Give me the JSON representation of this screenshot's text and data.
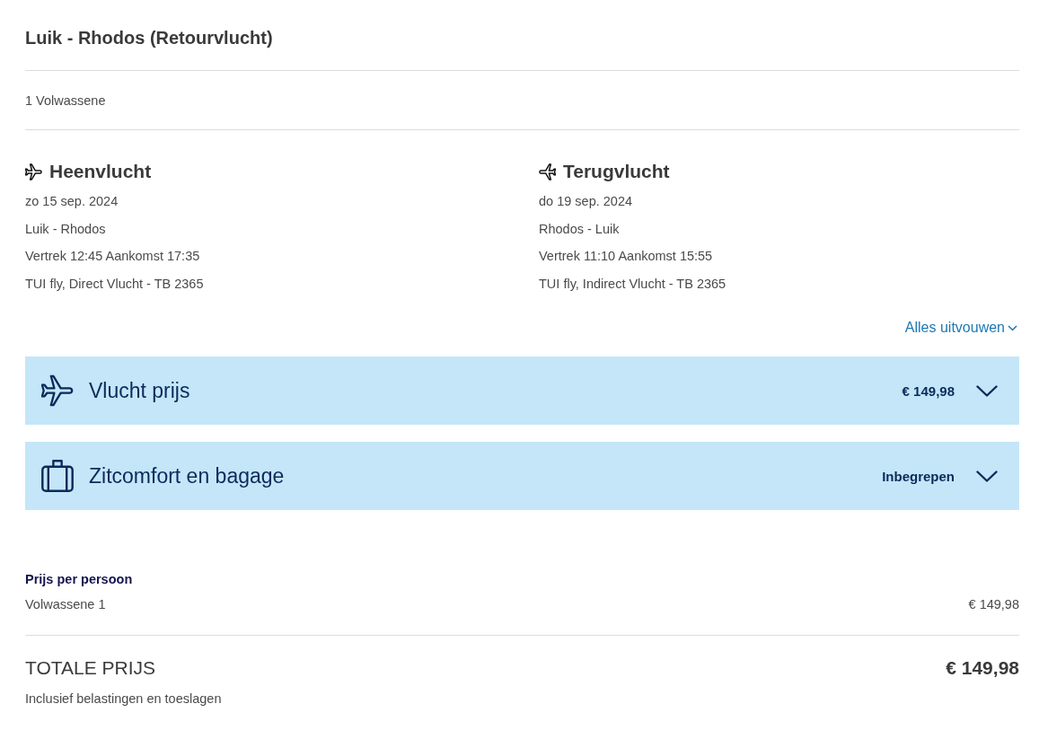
{
  "header": {
    "title": "Luik - Rhodos (Retourvlucht)"
  },
  "travellers": "1 Volwassene",
  "flights": [
    {
      "kind": "outbound",
      "heading": "Heenvlucht",
      "date": "zo 15 sep. 2024",
      "route": "Luik - Rhodos",
      "times": "Vertrek 12:45 Aankomst 17:35",
      "carrier": "TUI fly, Direct Vlucht - TB 2365"
    },
    {
      "kind": "return",
      "heading": "Terugvlucht",
      "date": "do 19 sep. 2024",
      "route": "Rhodos - Luik",
      "times": "Vertrek 11:10 Aankomst 15:55",
      "carrier": "TUI fly, Indirect Vlucht - TB 2365"
    }
  ],
  "expand_all_link": "Alles uitvouwen",
  "sections": [
    {
      "kind": "flight",
      "title": "Vlucht prijs",
      "value": "€ 149,98",
      "expanded": false
    },
    {
      "kind": "baggage",
      "title": "Zitcomfort en bagage",
      "value": "Inbegrepen",
      "expanded": false
    }
  ],
  "price_per_person": {
    "heading": "Prijs per persoon",
    "rows": [
      {
        "label": "Volwassene 1",
        "price": "€ 149,98"
      }
    ]
  },
  "total": {
    "label": "TOTALE PRIJS",
    "price": "€ 149,98",
    "note": "Inclusief belastingen en toeslagen"
  }
}
